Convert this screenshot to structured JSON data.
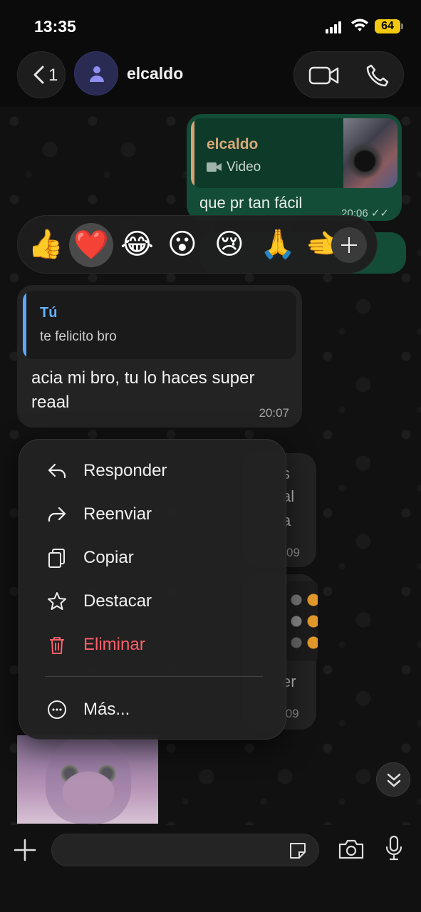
{
  "status_bar": {
    "time": "13:35",
    "battery": "64"
  },
  "header": {
    "back_count": "1",
    "contact_name": "elcaldo"
  },
  "messages": {
    "outgoing": {
      "quote_name": "elcaldo",
      "quote_type": "Video",
      "text": "que pr tan fácil",
      "time": "20:06"
    },
    "incoming": {
      "quote_name": "Tú",
      "quote_text": "te felicito bro",
      "text": "acia mi bro, tu lo haces super reaal",
      "time": "20:07"
    },
    "background_fragments": {
      "line1": "s",
      "line2": "al",
      "line3": "a",
      "time1": "09",
      "line4": "er",
      "time2": ":09"
    }
  },
  "reactions": [
    "👍",
    "❤️",
    "😂",
    "😮",
    "😢",
    "🙏",
    "🫲"
  ],
  "context_menu": {
    "reply": "Responder",
    "forward": "Reenviar",
    "copy": "Copiar",
    "star": "Destacar",
    "delete": "Eliminar",
    "more": "Más..."
  },
  "colors": {
    "outgoing_bubble": "#134d37",
    "incoming_bubble": "#232323",
    "danger": "#ff5f6a",
    "quote_accent": "#5aa9ff"
  }
}
